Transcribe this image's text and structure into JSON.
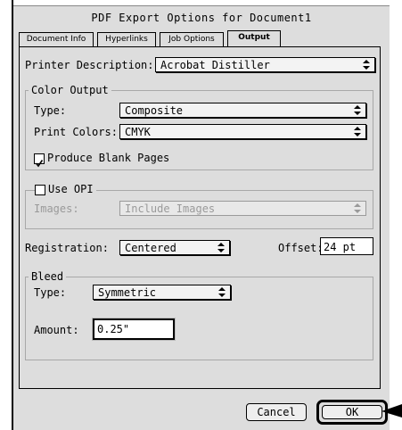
{
  "window": {
    "title": "PDF Export Options for Document1"
  },
  "tabs": [
    {
      "label": "Document Info"
    },
    {
      "label": "Hyperlinks"
    },
    {
      "label": "Job Options"
    },
    {
      "label": "Output",
      "active": true
    }
  ],
  "printer": {
    "label": "Printer Description:",
    "value": "Acrobat Distiller"
  },
  "color_output": {
    "title": "Color Output",
    "type_label": "Type:",
    "type_value": "Composite",
    "print_colors_label": "Print Colors:",
    "print_colors_value": "CMYK",
    "blank_pages_label": "Produce Blank Pages",
    "blank_pages_checked": true
  },
  "opi": {
    "label": "Use OPI",
    "checked": false,
    "images_label": "Images:",
    "images_value": "Include Images"
  },
  "registration": {
    "label": "Registration:",
    "value": "Centered",
    "offset_label": "Offset:",
    "offset_value": "24 pt"
  },
  "bleed": {
    "title": "Bleed",
    "type_label": "Type:",
    "type_value": "Symmetric",
    "amount_label": "Amount:",
    "amount_value": "0.25\""
  },
  "buttons": {
    "cancel": "Cancel",
    "ok": "OK"
  },
  "colors": {
    "window_bg": "#dddddd",
    "disabled_text": "#9a9a9a"
  }
}
